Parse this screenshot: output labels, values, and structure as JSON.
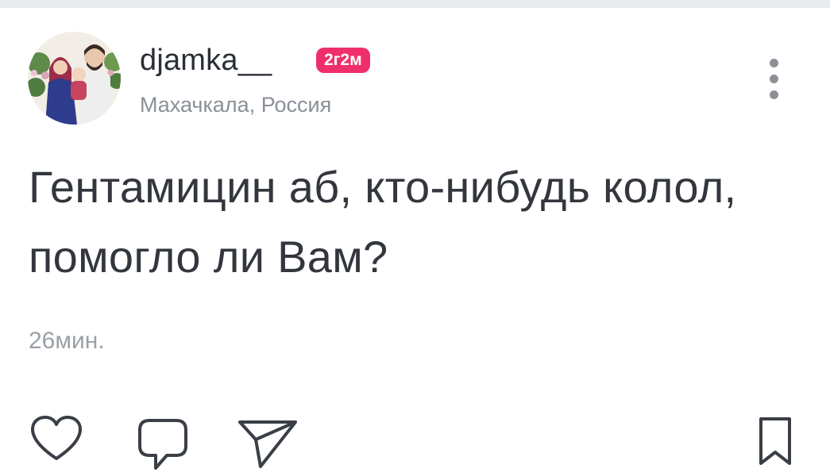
{
  "post": {
    "username": "djamka__",
    "badge": "2г2м",
    "location": "Махачкала, Россия",
    "text": "Гентамицин аб, кто-нибудь колол, помогло ли Вам?",
    "timestamp": "26мин."
  },
  "icons": {
    "menu": "more-vertical-icon",
    "like": "heart-icon",
    "comment": "comment-bubble-icon",
    "share": "send-paper-plane-icon",
    "save": "bookmark-icon"
  },
  "colors": {
    "badge": "#ef2f6b",
    "text": "#33373d",
    "muted": "#8a9098",
    "icon": "#3a3f46"
  }
}
